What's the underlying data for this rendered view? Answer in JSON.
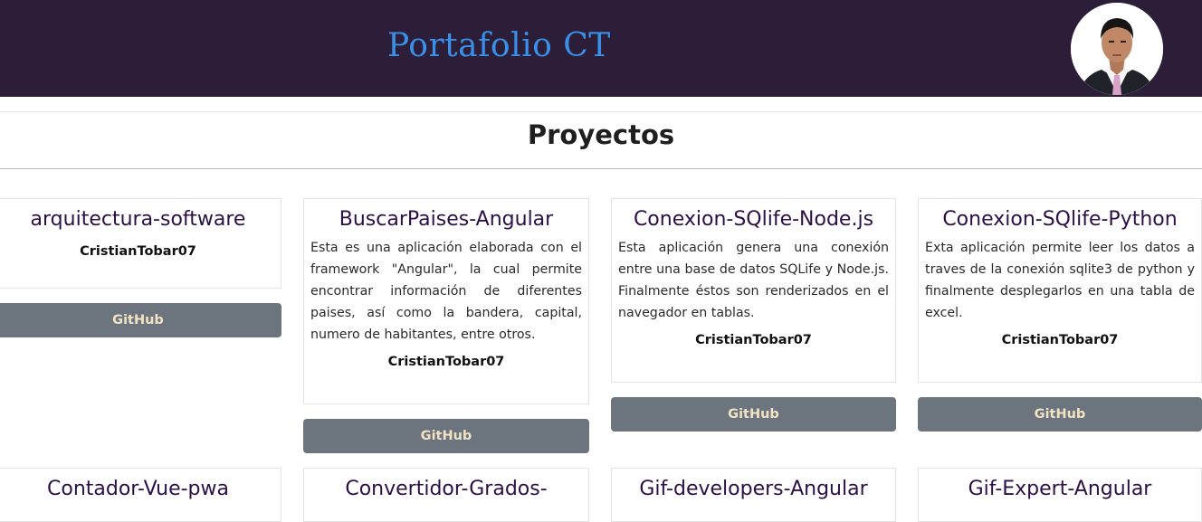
{
  "header": {
    "brand": "Portafolio CT"
  },
  "section": {
    "title": "Proyectos"
  },
  "projects": [
    {
      "title": "arquitectura-software",
      "description": "",
      "author": "CristianTobar07",
      "button": "GitHub"
    },
    {
      "title": "BuscarPaises-Angular",
      "description": "Esta es una aplicación elaborada con el framework \"Angular\", la cual permite encontrar información de diferentes paises, así como la bandera, capital, numero de habitantes, entre otros.",
      "author": "CristianTobar07",
      "button": "GitHub"
    },
    {
      "title": "Conexion-SQlife-Node.js",
      "description": "Esta aplicación genera una conexión entre una base de datos SQLife y Node.js. Finalmente éstos son renderizados en el navegador en tablas.",
      "author": "CristianTobar07",
      "button": "GitHub"
    },
    {
      "title": "Conexion-SQlife-Python",
      "description": "Exta aplicación permite leer los datos a traves de la conexión sqlite3 de python y finalmente desplegarlos en una tabla de excel.",
      "author": "CristianTobar07",
      "button": "GitHub"
    },
    {
      "title": "Contador-Vue-pwa"
    },
    {
      "title": "Convertidor-Grados-"
    },
    {
      "title": "Gif-developers-Angular"
    },
    {
      "title": "Gif-Expert-Angular"
    }
  ]
}
